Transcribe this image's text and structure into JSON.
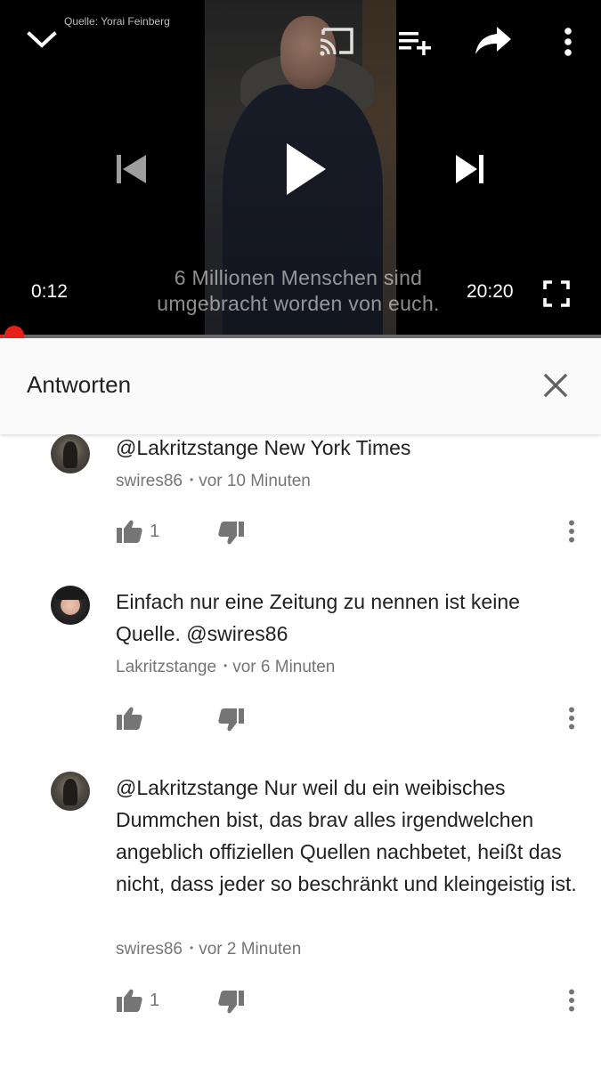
{
  "player": {
    "source_caption": "Quelle: Yorai Feinberg",
    "subtitle_line1": "6 Millionen Menschen sind",
    "subtitle_line2": "umgebracht worden von euch.",
    "current_time": "0:12",
    "total_time": "20:20",
    "progress_fraction": 0.006,
    "accent_color": "#e62117",
    "icons": [
      "chevron-down-icon",
      "cast-icon",
      "add-to-playlist-icon",
      "share-icon",
      "more-vert-icon",
      "previous-icon",
      "play-icon",
      "next-icon",
      "fullscreen-icon"
    ]
  },
  "replies": {
    "title": "Antworten",
    "comments": [
      {
        "text": "@Lakritzstange New York Times",
        "author": "swires86",
        "separator": "•",
        "time": "vor 10 Minuten",
        "likes": "1",
        "avatar": "knight-avatar"
      },
      {
        "text": "Einfach nur eine Zeitung zu nennen ist keine Quelle. @swires86",
        "author": "Lakritzstange",
        "separator": "•",
        "time": "vor 6 Minuten",
        "likes": "",
        "avatar": "woman-avatar"
      },
      {
        "text": "@Lakritzstange Nur weil du ein weibisches Dummchen bist, das brav alles irgendwelchen angeblich offiziellen Quellen nachbetet, heißt das nicht, dass jeder so beschränkt und kleingeistig ist.",
        "author": "swires86",
        "separator": "•",
        "time": "vor 2 Minuten",
        "likes": "1",
        "avatar": "knight-avatar"
      }
    ]
  }
}
